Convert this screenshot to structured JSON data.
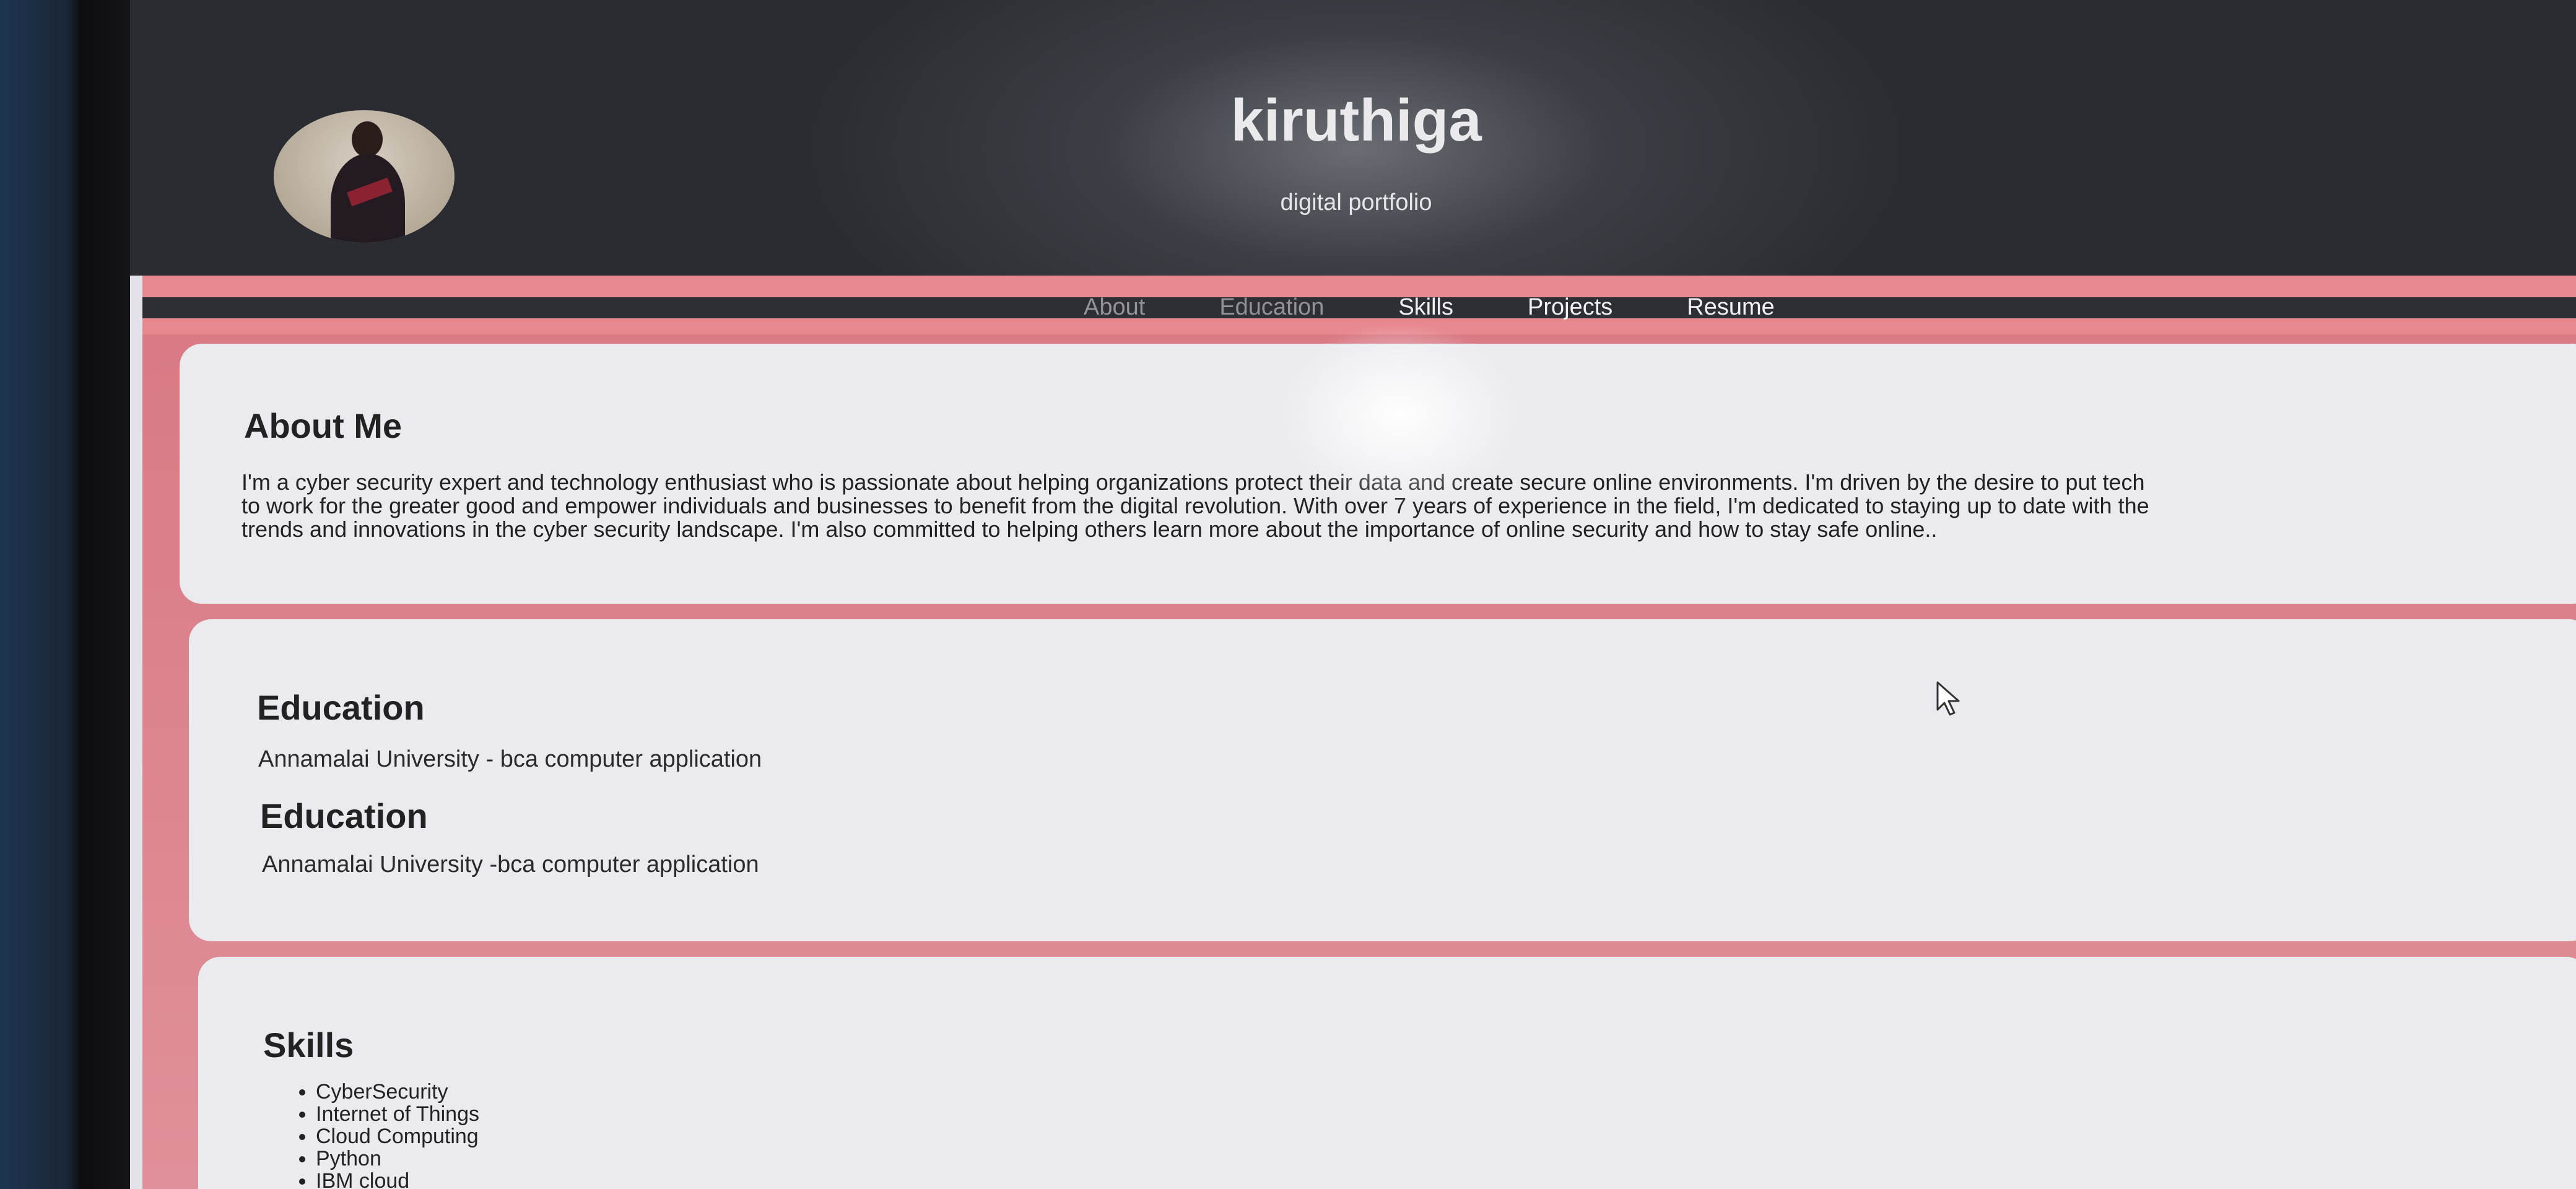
{
  "header": {
    "title": "kiruthiga",
    "subtitle": "digital portfolio"
  },
  "nav": {
    "items": [
      {
        "label": "About"
      },
      {
        "label": "Education"
      },
      {
        "label": "Skills"
      },
      {
        "label": "Projects"
      },
      {
        "label": "Resume"
      }
    ]
  },
  "about": {
    "heading": "About Me",
    "lines": [
      "I'm a cyber security expert and technology enthusiast who is passionate about helping organizations protect their data and create secure online environments. I'm driven by the desire to put tech",
      "to work for the greater good and empower individuals and businesses to benefit from the digital revolution. With over 7 years of experience in the field, I'm dedicated to staying up to date with the",
      "trends and innovations in the cyber security landscape. I'm also committed to helping others learn more about the importance of online security and how to stay safe online.."
    ]
  },
  "education": {
    "entries": [
      {
        "heading": "Education",
        "detail": "Annamalai University - bca computer application"
      },
      {
        "heading": "Education",
        "detail": "Annamalai University -bca computer application"
      }
    ]
  },
  "skills": {
    "heading": "Skills",
    "items": [
      "CyberSecurity",
      "Internet of Things",
      "Cloud Computing",
      "Python",
      "IBM cloud"
    ]
  },
  "icons": {
    "cursor": "mouse-pointer-icon"
  },
  "colors": {
    "header_bg": "#2f3136",
    "accent_pink": "#e0848d",
    "card_bg": "#ebeaee"
  }
}
